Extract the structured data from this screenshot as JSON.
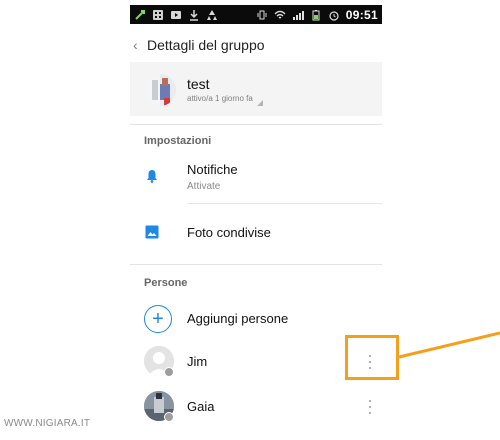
{
  "status_bar": {
    "time": "09:51",
    "icons": [
      "usb-icon",
      "bbm-icon",
      "youtube-icon",
      "download-icon",
      "recycle-icon",
      "vibrate-icon",
      "wifi-icon",
      "signal-icon",
      "battery-icon",
      "alarm-icon"
    ]
  },
  "header": {
    "back_glyph": "‹",
    "title": "Dettagli del gruppo"
  },
  "group": {
    "name": "test",
    "status": "attivo/a 1 giorno fa"
  },
  "settings": {
    "section_label": "Impostazioni",
    "notifications": {
      "label": "Notifiche",
      "sub": "Attivate"
    },
    "shared_photos": {
      "label": "Foto condivise"
    }
  },
  "people": {
    "section_label": "Persone",
    "add_label": "Aggiungi persone",
    "add_glyph": "+",
    "members": [
      {
        "name": "Jim"
      },
      {
        "name": "Gaia"
      }
    ]
  },
  "annotation": {
    "color": "#f4a01c"
  },
  "watermark": {
    "text": "WWW.NIGIARA.IT"
  },
  "colors": {
    "accent": "#1e88e5",
    "status_bar": "#0b0b0b"
  }
}
